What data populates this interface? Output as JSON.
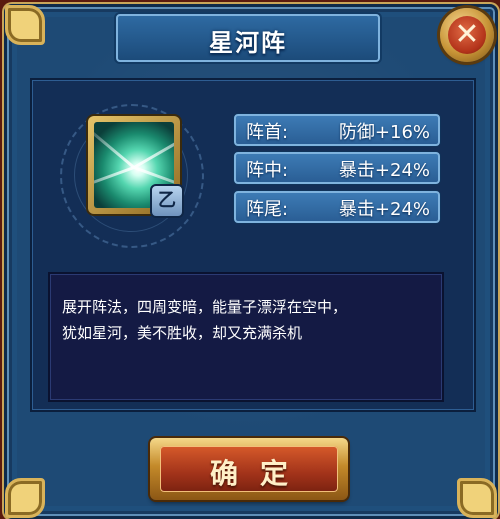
{
  "dialog": {
    "title": "星河阵",
    "close_icon": "close-x-icon",
    "confirm_label": "确定"
  },
  "skill": {
    "icon": "star-river-formation-icon",
    "grade": "乙"
  },
  "stats": [
    {
      "position": "阵首:",
      "effect": "防御+16%"
    },
    {
      "position": "阵中:",
      "effect": "暴击+24%"
    },
    {
      "position": "阵尾:",
      "effect": "暴击+24%"
    }
  ],
  "description": {
    "line1": "展开阵法，四周变暗，能量子漂浮在空中，",
    "line2": "犹如星河，美不胜收，却又充满杀机"
  },
  "colors": {
    "frame": "#1f4f7c",
    "panel": "#132e56",
    "desc_bg": "#141a44",
    "gold": "#d9b35a",
    "confirm_red": "#a2331a"
  }
}
